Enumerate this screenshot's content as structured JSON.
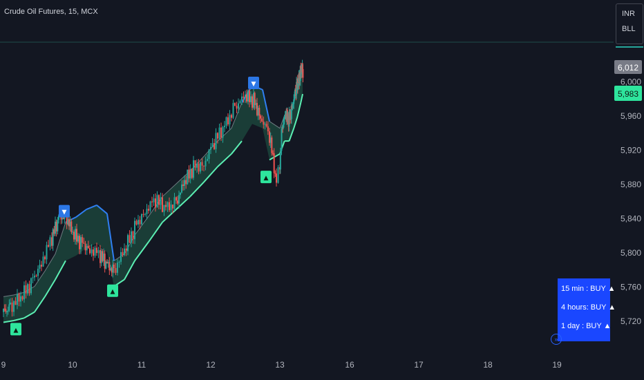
{
  "header": {
    "title": "Crude Oil Futures, 15, MCX"
  },
  "currency_box": {
    "currency": "INR",
    "unit": "BLL"
  },
  "timeframe_table": [
    {
      "label": "15 min : BUY ▲"
    },
    {
      "label": "4 hours: BUY ▲"
    },
    {
      "label": "1 day  : BUY ▲"
    }
  ],
  "icons": {
    "go_to_realtime": "arrow-right-circle-icon"
  },
  "colors": {
    "background": "#131722",
    "up_candle": "#26a69a",
    "down_candle": "#ef5350",
    "bull_band_line": "#5cf0b4",
    "bull_band_fill": "#1d4b3f",
    "bear_band_line": "#2f7ff2",
    "bear_band_fill": "#1c3a5e",
    "mid_line": "#c7ccd6",
    "buy_label_bg": "#2ee59d",
    "sell_label_bg": "#2c77e6",
    "current_price_bg": "#787b86",
    "band_price_bg": "#2ee59d",
    "table_bg": "#1a47ff"
  },
  "chart_data": {
    "type": "line",
    "title": "Crude Oil Futures, 15, MCX",
    "x_ticks": [
      "9",
      "10",
      "11",
      "12",
      "13",
      "16",
      "17",
      "18",
      "19"
    ],
    "y_ticks": [
      5720,
      5760,
      5800,
      5840,
      5880,
      5920,
      5960,
      6000
    ],
    "ylim": [
      5700,
      6030
    ],
    "grid": false,
    "current_price_label": "6,012",
    "band_price_label": "5,983",
    "series": [
      {
        "type": "candles",
        "x": [
          9.0,
          9.1,
          9.25,
          9.4,
          9.55,
          9.7,
          9.8,
          9.9,
          10.0,
          10.12,
          10.25,
          10.4,
          10.5,
          10.6,
          10.75,
          10.9,
          11.05,
          11.2,
          11.35,
          11.5,
          11.62,
          11.75,
          11.9,
          12.05,
          12.2,
          12.35,
          12.5,
          12.62,
          12.72,
          12.85,
          12.95,
          13.1,
          13.25,
          13.4,
          13.55,
          13.7,
          13.8,
          13.9,
          13.95
        ],
        "y": [
          5730,
          5738,
          5745,
          5765,
          5790,
          5815,
          5840,
          5845,
          5820,
          5812,
          5805,
          5795,
          5785,
          5780,
          5800,
          5830,
          5850,
          5860,
          5852,
          5860,
          5880,
          5900,
          5905,
          5928,
          5948,
          5972,
          5980,
          5978,
          5960,
          5935,
          5882,
          5948,
          5958,
          5955,
          5975,
          5990,
          6000,
          6012,
          6012
        ]
      },
      {
        "type": "band",
        "x": [
          9.0,
          9.15,
          9.3,
          9.45,
          9.6,
          9.75,
          9.9,
          10.05,
          10.2,
          10.35,
          10.5,
          10.6,
          10.75,
          10.9,
          11.1,
          11.3,
          11.5,
          11.7,
          11.9,
          12.1,
          12.3,
          12.45,
          12.6,
          12.75,
          12.85,
          13.0,
          13.2,
          13.4,
          13.6,
          13.75,
          13.9,
          13.98
        ],
        "y": [
          5718,
          5720,
          5723,
          5730,
          5748,
          5768,
          5790,
          5796,
          5805,
          5810,
          5800,
          5760,
          5768,
          5790,
          5812,
          5835,
          5850,
          5865,
          5882,
          5900,
          5915,
          5930,
          5950,
          5945,
          5908,
          5915,
          5930,
          5930,
          5945,
          5958,
          5975,
          5985
        ]
      }
    ],
    "signals": [
      {
        "x": 9.18,
        "y": 5710,
        "label": "▲",
        "side": "buy"
      },
      {
        "x": 9.88,
        "y": 5848,
        "label": "▼",
        "side": "sell"
      },
      {
        "x": 10.58,
        "y": 5755,
        "label": "▲",
        "side": "buy"
      },
      {
        "x": 12.62,
        "y": 5998,
        "label": "▼",
        "side": "sell"
      },
      {
        "x": 12.8,
        "y": 5888,
        "label": "▲",
        "side": "buy"
      }
    ]
  }
}
